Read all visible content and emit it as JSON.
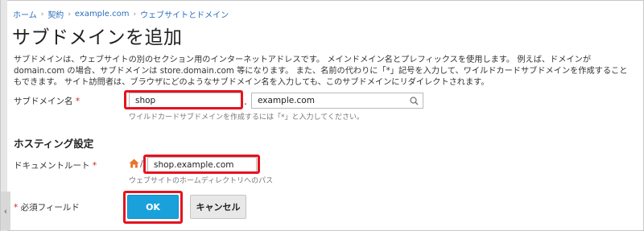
{
  "breadcrumb": [
    "ホーム",
    "契約",
    "example.com",
    "ウェブサイトとドメイン"
  ],
  "page_title": "サブドメインを追加",
  "description": "サブドメインは、ウェブサイトの別のセクション用のインターネットアドレスです。 メインドメイン名とプレフィックスを使用します。 例えば、ドメインが domain.com の場合、サブドメインは store.domain.com 等になります。 また、名前の代わりに「*」記号を入力して、ワイルドカードサブドメインを作成することもできます。 サイト訪問者は、ブラウザにどのようなサブドメイン名を入力しても、このサブドメインにリダイレクトされます。",
  "subdomain": {
    "label": "サブドメイン名",
    "required_mark": "*",
    "value": "shop",
    "separator": ".",
    "domain_value": "example.com",
    "hint": "ワイルドカードサブドメインを作成するには「*」と入力してください。"
  },
  "hosting": {
    "section_title": "ホスティング設定",
    "docroot_label": "ドキュメントルート",
    "required_mark": "*",
    "path_separator": "/",
    "docroot_value": "shop.example.com",
    "hint": "ウェブサイトのホームディレクトリへのパス"
  },
  "required_note": {
    "mark": "*",
    "text": "必須フィールド"
  },
  "buttons": {
    "ok": "OK",
    "cancel": "キャンセル"
  },
  "icons": {
    "collapse": "chevron-left-icon",
    "search": "search-icon",
    "home": "home-icon"
  },
  "colors": {
    "highlight": "#e4141e",
    "ok_button": "#1aa1dc",
    "link": "#2a6ebb"
  }
}
